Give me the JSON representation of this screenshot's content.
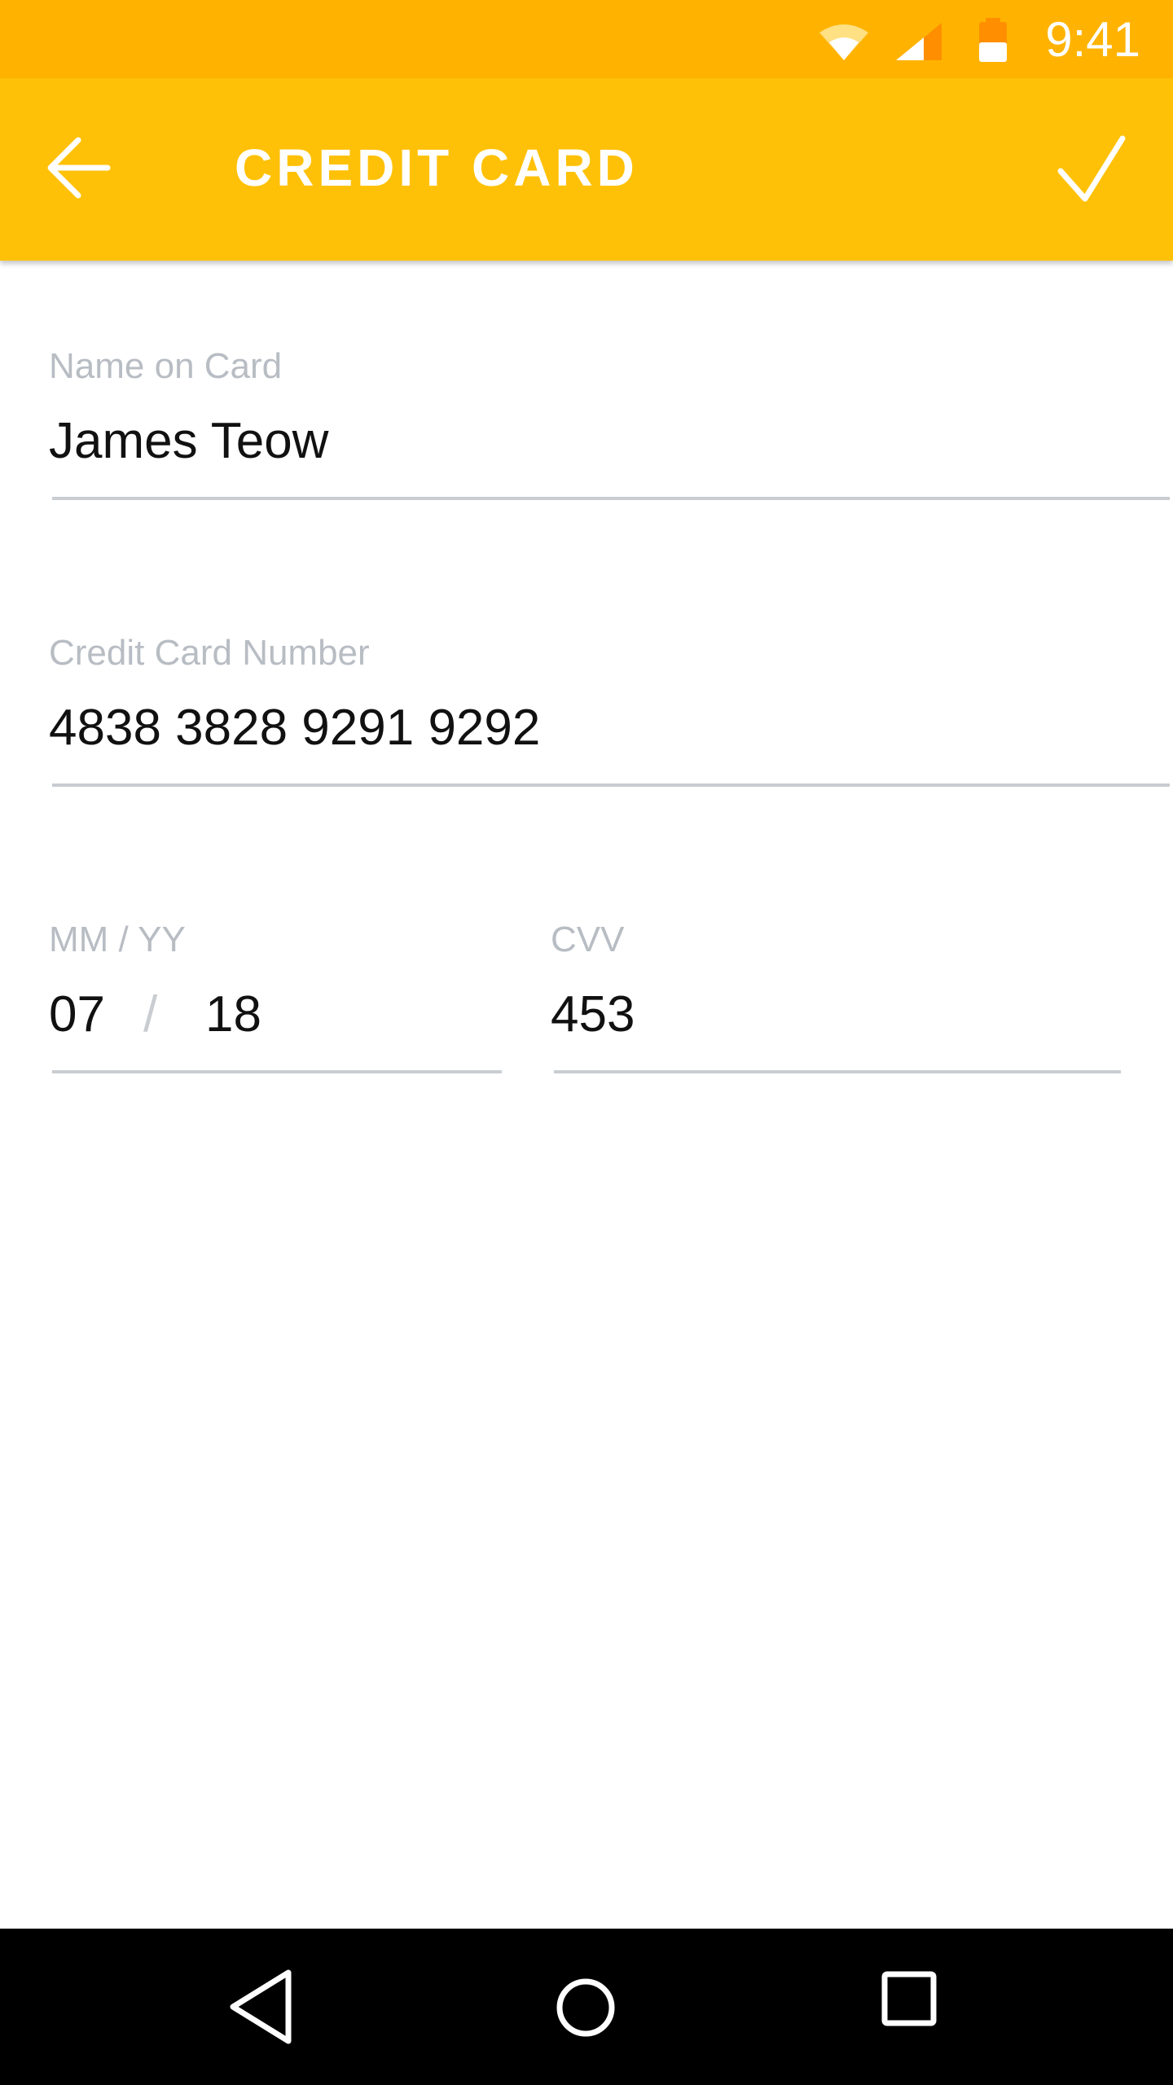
{
  "status_bar": {
    "time": "9:41",
    "icons": [
      "wifi-icon",
      "cell-signal-icon",
      "battery-icon"
    ],
    "background": "#FFB300"
  },
  "app_bar": {
    "title": "CREDIT CARD",
    "back_icon": "arrow-left-icon",
    "confirm_icon": "checkmark-icon",
    "background": "#FFC107"
  },
  "form": {
    "name": {
      "label": "Name on Card",
      "value": "James Teow"
    },
    "number": {
      "label": "Credit Card Number",
      "value": "4838 3828 9291 9292"
    },
    "expiry": {
      "label": "MM / YY",
      "month": "07",
      "separator": "/",
      "year": "18"
    },
    "cvv": {
      "label": "CVV",
      "value": "453"
    }
  },
  "nav_bar": {
    "icons": [
      "nav-back-icon",
      "nav-home-icon",
      "nav-recents-icon"
    ],
    "background": "#000000"
  },
  "colors": {
    "label_text": "#B8BDC4",
    "value_text": "#111111",
    "underline": "#C9CDD1"
  }
}
